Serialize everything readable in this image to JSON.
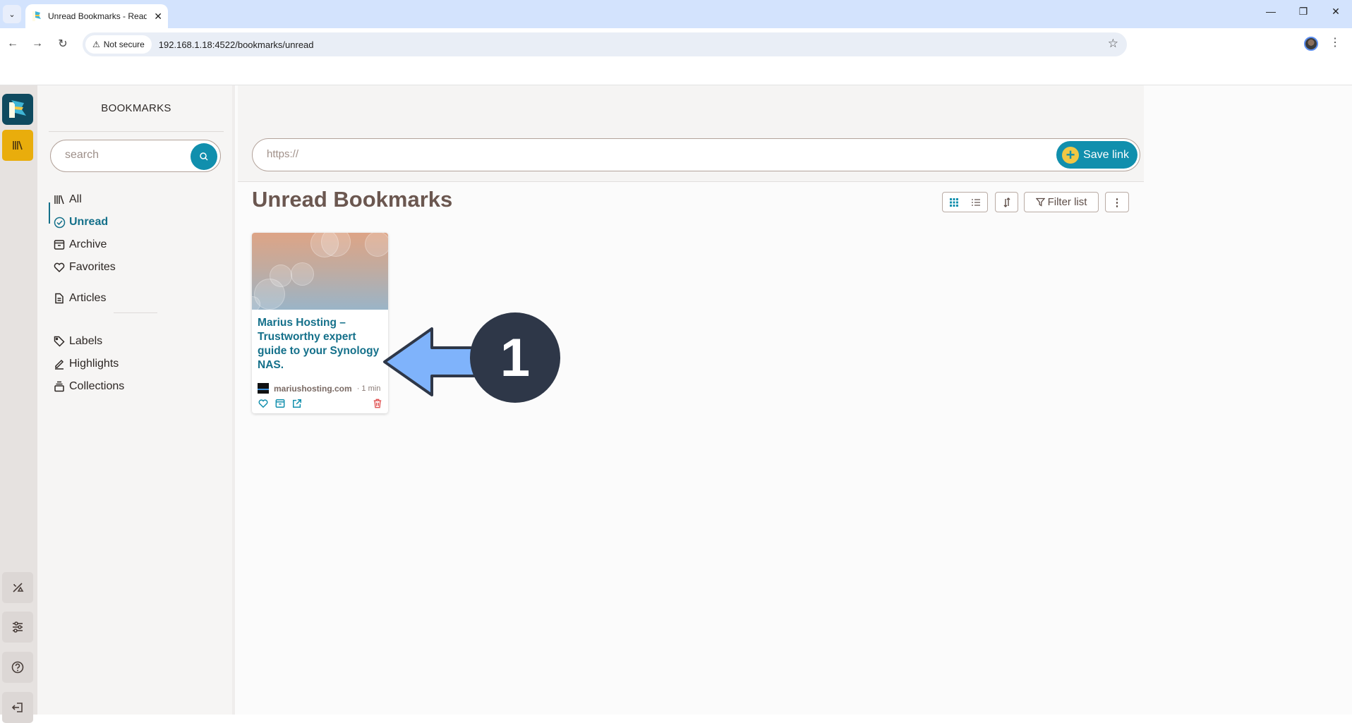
{
  "browser": {
    "tab_title": "Unread Bookmarks - Readeck",
    "security_label": "Not secure",
    "url": "192.168.1.18:4522/bookmarks/unread"
  },
  "sidebar": {
    "section_title": "BOOKMARKS",
    "search_placeholder": "search",
    "items": [
      {
        "id": "all",
        "label": "All",
        "icon": "library-icon"
      },
      {
        "id": "unread",
        "label": "Unread",
        "icon": "check-circle-icon",
        "active": true
      },
      {
        "id": "archive",
        "label": "Archive",
        "icon": "archive-icon"
      },
      {
        "id": "favorites",
        "label": "Favorites",
        "icon": "heart-icon"
      },
      {
        "id": "articles",
        "label": "Articles",
        "icon": "document-icon"
      },
      {
        "id": "labels",
        "label": "Labels",
        "icon": "tag-icon"
      },
      {
        "id": "highlights",
        "label": "Highlights",
        "icon": "highlighter-icon"
      },
      {
        "id": "collections",
        "label": "Collections",
        "icon": "collection-icon"
      }
    ]
  },
  "rail": {
    "items": [
      "bookmarks-icon"
    ],
    "bottom_items": [
      "theme-toggle-icon",
      "settings-sliders-icon",
      "help-icon",
      "logout-icon"
    ]
  },
  "main": {
    "url_placeholder": "https://",
    "save_label": "Save link",
    "title": "Unread Bookmarks",
    "filter_label": "Filter list",
    "view_mode": "grid"
  },
  "bookmarks": [
    {
      "title": "Marius Hosting – Trustworthy expert guide to your Synology NAS.",
      "site": "mariushosting.com",
      "read_time": "· 1 min"
    }
  ],
  "annotation": {
    "number": "1"
  },
  "colors": {
    "accent": "#118fad",
    "active_nav": "#14708a",
    "rail_active": "#e9ad0c",
    "delete": "#e05252",
    "annotation_arrow": "#7fb3fb",
    "annotation_circle": "#2e3748"
  }
}
